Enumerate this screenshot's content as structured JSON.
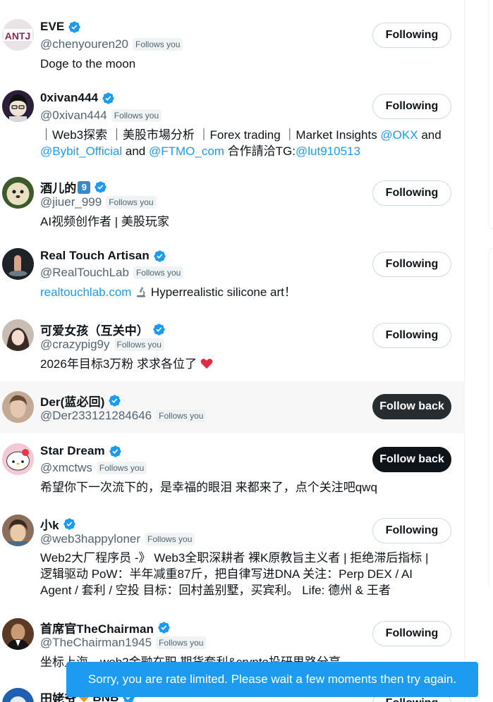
{
  "follow_list": {
    "users": [
      {
        "name": "EVE",
        "handle": "@chenyouren20",
        "follows_you": "Follows you",
        "bio": "Doge to the moon",
        "button": "Following"
      },
      {
        "name": "0xivan444",
        "handle": "@0xivan444",
        "follows_you": "Follows you",
        "bio_parts": {
          "text1": "｜Web3探索 ｜美股市場分析 ｜Forex trading ｜Market Insights ",
          "link1": "@OKX",
          "text2": " and",
          "link2": "@Bybit_Official",
          "text3": " and ",
          "link3": "@FTMO_com",
          "text4": " 合作請洽TG:",
          "link4": "@lut910513"
        },
        "button": "Following"
      },
      {
        "name": "酒儿的",
        "name_emoji": "9",
        "handle": "@jiuer_999",
        "follows_you": "Follows you",
        "bio": "AI视频创作者 | 美股玩家",
        "button": "Following"
      },
      {
        "name": "Real Touch Artisan",
        "handle": "@RealTouchLab",
        "follows_you": "Follows you",
        "bio_link": "realtouchlab.com",
        "bio_text": " Hyperrealistic silicone art！",
        "bio_icon": "microscope-icon",
        "button": "Following"
      },
      {
        "name": "可爱女孩（互关中）",
        "handle": "@crazypig9y",
        "follows_you": "Follows you",
        "bio": "2026年目标3万粉 求求各位了",
        "bio_icon": "red-heart-icon",
        "button": "Following"
      },
      {
        "name": "Der(蓝必回)",
        "handle": "@Der233121284646",
        "follows_you": "Follows you",
        "button": "Follow back"
      },
      {
        "name": "Star Dream",
        "handle": "@xmctws",
        "follows_you": "Follows you",
        "bio": "希望你下一次流下的，是幸福的眼泪 来都来了，点个关注吧qwq",
        "button": "Follow back"
      },
      {
        "name": "小k",
        "handle": "@web3happyloner",
        "follows_you": "Follows you",
        "bio_lines": [
          "Web2大厂程序员 -》 Web3全职深耕者  裸K原教旨主义者 | 拒绝滞后指标 |",
          "逻辑驱动  PoW：半年减重87斤，把自律写进DNA  关注：Perp DEX / AI",
          "Agent / 套利 / 空投  目标：回村盖别墅，买宾利。 Life: 德州 & 王者"
        ],
        "button": "Following"
      },
      {
        "name": "首席官TheChairman",
        "handle": "@TheChairman1945",
        "follows_you": "Follows you",
        "bio": "坐标上海，web2金融在职 期货套利&crypto投研思路分享",
        "button": "Following"
      },
      {
        "name": "田姥爷",
        "name_suffix": "BNB",
        "button": "Following"
      }
    ]
  },
  "toast": {
    "message": "Sorry, you are rate limited. Please wait a few moments then try again."
  },
  "colors": {
    "accent": "#1d9bf0",
    "verified": "#1d9bf0",
    "text": "#0f1419",
    "muted": "#536471",
    "border": "#cfd9de"
  }
}
